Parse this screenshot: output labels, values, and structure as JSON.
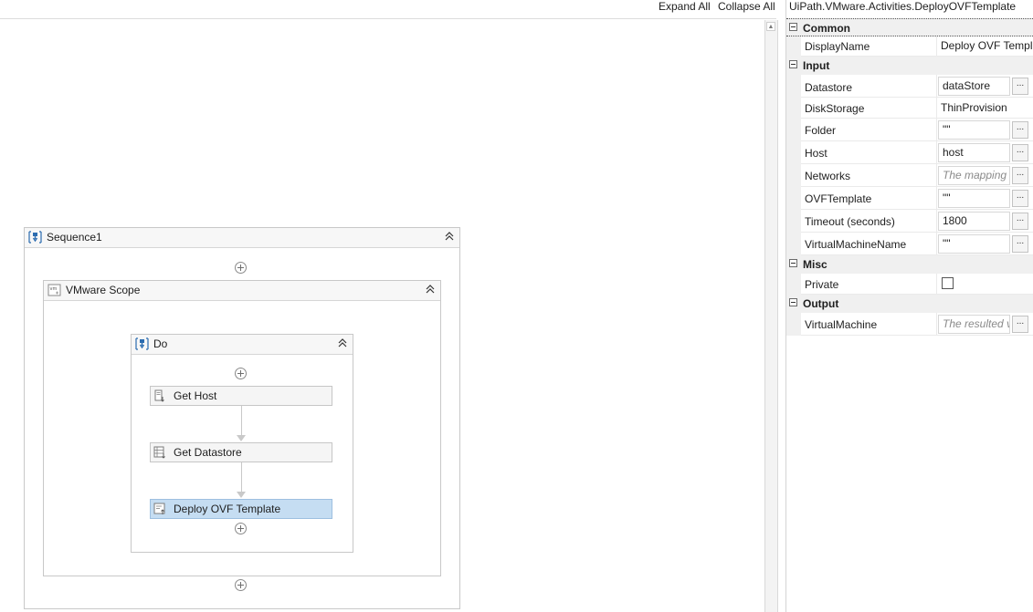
{
  "toolbar": {
    "expand_all": "Expand All",
    "collapse_all": "Collapse All"
  },
  "workflow": {
    "sequence": {
      "title": "Sequence1",
      "icon": "sequence-icon"
    },
    "scope": {
      "title": "VMware Scope",
      "icon": "vm-icon"
    },
    "do_block": {
      "title": "Do",
      "icon": "sequence-icon"
    },
    "activities": [
      {
        "label": "Get Host",
        "icon": "host-icon",
        "selected": false
      },
      {
        "label": "Get Datastore",
        "icon": "datastore-icon",
        "selected": false
      },
      {
        "label": "Deploy OVF Template",
        "icon": "deploy-icon",
        "selected": true
      }
    ]
  },
  "properties": {
    "title": "UiPath.VMware.Activities.DeployOVFTemplate",
    "categories": {
      "common": "Common",
      "input": "Input",
      "misc": "Misc",
      "output": "Output"
    },
    "display_name": {
      "name": "DisplayName",
      "value": "Deploy OVF Templ"
    },
    "datastore": {
      "name": "Datastore",
      "value": "dataStore"
    },
    "disk_storage": {
      "name": "DiskStorage",
      "value": "ThinProvision"
    },
    "folder": {
      "name": "Folder",
      "value": "\"\""
    },
    "host": {
      "name": "Host",
      "value": "host"
    },
    "networks": {
      "name": "Networks",
      "placeholder": "The mapping"
    },
    "ovf_template": {
      "name": "OVFTemplate",
      "value": "\"\""
    },
    "timeout": {
      "name": "Timeout (seconds)",
      "value": "1800"
    },
    "vm_name": {
      "name": "VirtualMachineName",
      "value": "\"\""
    },
    "private": {
      "name": "Private",
      "checked": false
    },
    "virtual_machine": {
      "name": "VirtualMachine",
      "placeholder": "The resulted v"
    },
    "ellipsis_label": "..."
  },
  "colors": {
    "selected_activity": "#c5ddf2",
    "category_band": "#f0f0f0"
  }
}
